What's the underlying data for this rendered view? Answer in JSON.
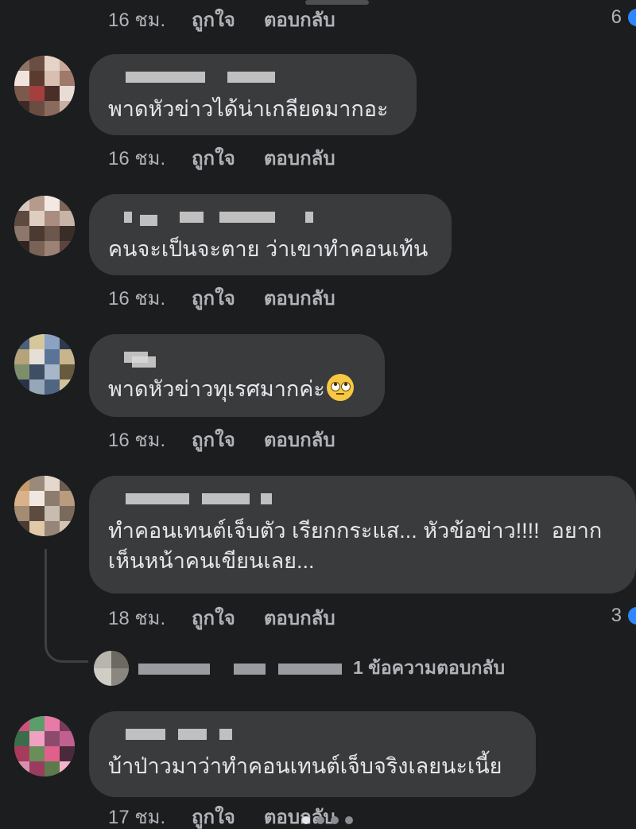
{
  "comments": [
    {
      "time": "16 ชม.",
      "like": "ถูกใจ",
      "reply": "ตอบกลับ",
      "reactions": "6"
    },
    {
      "text": "พาดหัวข่าวได้น่าเกลียดมากอะ",
      "time": "16 ชม.",
      "like": "ถูกใจ",
      "reply": "ตอบกลับ"
    },
    {
      "text": "คนจะเป็นจะตาย ว่าเขาทำคอนเท้น",
      "time": "16 ชม.",
      "like": "ถูกใจ",
      "reply": "ตอบกลับ"
    },
    {
      "text": "พาดหัวข่าวทุเรศมากค่ะ",
      "emoji": "face-with-rolling-eyes",
      "time": "16 ชม.",
      "like": "ถูกใจ",
      "reply": "ตอบกลับ"
    },
    {
      "text": "ทำคอนเทนต์เจ็บตัว เรียกกระแส... หัวข้อข่าว!!!!  อยาก\nเห็นหน้าคนเขียนเลย...",
      "time": "18 ชม.",
      "like": "ถูกใจ",
      "reply": "ตอบกลับ",
      "reactions": "3",
      "replies_summary": "1 ข้อความตอบกลับ"
    },
    {
      "text": "บ้าป่าวมาว่าทำคอนเทนต์เจ็บจริงเลยนะเนี้ย",
      "time": "17 ชม.",
      "like": "ถูกใจ",
      "reply": "ตอบกลับ"
    }
  ],
  "colors": {
    "background": "#1c1d1f",
    "bubble": "#3a3b3c",
    "meta_text": "#b0b3b8",
    "body_text": "#e4e6eb",
    "reaction_blue": "#2d88ff"
  },
  "icons": {
    "emoji": "face-with-rolling-eyes-icon",
    "reaction": "like-reaction-icon"
  }
}
